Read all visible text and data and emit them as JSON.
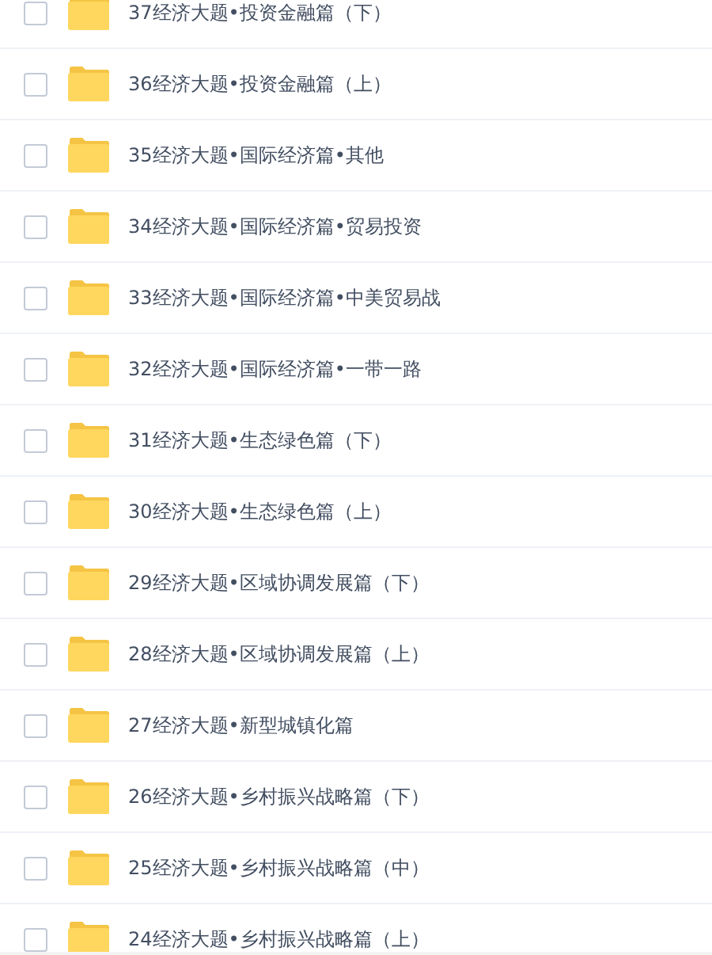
{
  "files": [
    {
      "name": "37经济大题•投资金融篇（下）",
      "checked": false
    },
    {
      "name": "36经济大题•投资金融篇（上）",
      "checked": false
    },
    {
      "name": "35经济大题•国际经济篇•其他",
      "checked": false
    },
    {
      "name": "34经济大题•国际经济篇•贸易投资",
      "checked": false
    },
    {
      "name": "33经济大题•国际经济篇•中美贸易战",
      "checked": false
    },
    {
      "name": "32经济大题•国际经济篇•一带一路",
      "checked": false
    },
    {
      "name": "31经济大题•生态绿色篇（下）",
      "checked": false
    },
    {
      "name": "30经济大题•生态绿色篇（上）",
      "checked": false
    },
    {
      "name": "29经济大题•区域协调发展篇（下）",
      "checked": false
    },
    {
      "name": "28经济大题•区域协调发展篇（上）",
      "checked": false
    },
    {
      "name": "27经济大题•新型城镇化篇",
      "checked": false
    },
    {
      "name": "26经济大题•乡村振兴战略篇（下）",
      "checked": false
    },
    {
      "name": "25经济大题•乡村振兴战略篇（中）",
      "checked": false
    },
    {
      "name": "24经济大题•乡村振兴战略篇（上）",
      "checked": false
    }
  ]
}
